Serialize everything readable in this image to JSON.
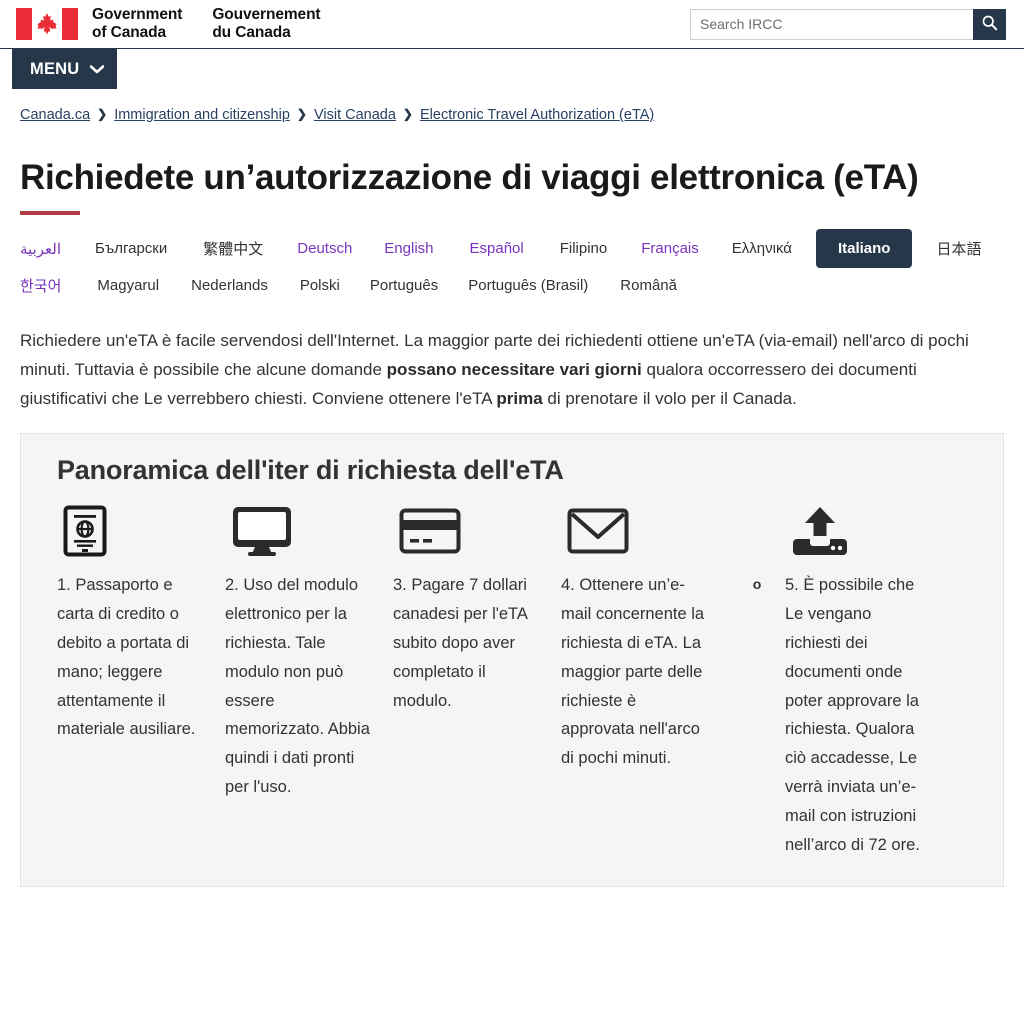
{
  "header": {
    "flag_icon": "canada-flag-icon",
    "wordmark_en": "Government\nof Canada",
    "wordmark_fr": "Gouvernement\ndu Canada",
    "search": {
      "placeholder": "Search IRCC",
      "value": "",
      "button_icon": "search-icon"
    },
    "menu": {
      "label": "MENU",
      "icon": "chevron-down-icon"
    }
  },
  "breadcrumb": {
    "separator": "❯",
    "items": [
      {
        "label": "Canada.ca"
      },
      {
        "label": "Immigration and citizenship"
      },
      {
        "label": "Visit Canada"
      },
      {
        "label": "Electronic Travel Authorization (eTA)"
      }
    ]
  },
  "page": {
    "title": "Richiedete un’autorizzazione di viaggi elettronica (eTA)"
  },
  "languages": {
    "active": "Italiano",
    "row1": [
      {
        "label": "العربية",
        "visited": true,
        "active": false
      },
      {
        "label": "Български",
        "visited": false,
        "active": false
      },
      {
        "label": "繁體中文",
        "visited": false,
        "active": false
      },
      {
        "label": "Deutsch",
        "visited": true,
        "active": false
      },
      {
        "label": "English",
        "visited": true,
        "active": false
      },
      {
        "label": "Español",
        "visited": true,
        "active": false
      },
      {
        "label": "Filipino",
        "visited": false,
        "active": false
      },
      {
        "label": "Français",
        "visited": true,
        "active": false
      },
      {
        "label": "Ελληνικά",
        "visited": false,
        "active": false
      },
      {
        "label": "Italiano",
        "visited": false,
        "active": true
      },
      {
        "label": "日本語",
        "visited": false,
        "active": false
      }
    ],
    "row2": [
      {
        "label": "한국어",
        "visited": true,
        "active": false
      },
      {
        "label": "Magyarul",
        "visited": false,
        "active": false
      },
      {
        "label": "Nederlands",
        "visited": false,
        "active": false
      },
      {
        "label": "Polski",
        "visited": false,
        "active": false
      },
      {
        "label": "Português",
        "visited": false,
        "active": false
      },
      {
        "label": "Português (Brasil)",
        "visited": false,
        "active": false
      },
      {
        "label": "Română",
        "visited": false,
        "active": false
      }
    ]
  },
  "intro": {
    "part1": "Richiedere un'eTA è facile servendosi dell'Internet. La maggior parte dei richiedenti ottiene un'eTA (via-email) nell'arco di pochi minuti. Tuttavia è possibile che alcune domande ",
    "bold1": "possano necessitare vari giorni",
    "part2": " qualora occorressero dei documenti giustificativi che Le verrebbero chiesti. Conviene ottenere l'eTA ",
    "bold2": "prima",
    "part3": " di prenotare il volo per il Canada."
  },
  "overview": {
    "title": "Panoramica dell'iter di richiesta dell'eTA",
    "or_label": "o",
    "steps": [
      {
        "icon": "passport-icon",
        "text": "1. Passaporto e carta di credito o debito a portata di mano; leggere attentamente il materiale ausiliare."
      },
      {
        "icon": "monitor-icon",
        "text": "2. Uso del modulo elettronico per la richiesta. Tale modulo non può essere memorizzato. Abbia quindi i dati pronti per l'uso."
      },
      {
        "icon": "credit-card-icon",
        "text": "3. Pagare 7 dollari canadesi per l'eTA subito dopo aver completato il modulo."
      },
      {
        "icon": "envelope-icon",
        "text": "4. Ottenere un’e-mail concernente la richiesta di eTA. La maggior parte delle richieste è approvata nell'arco di pochi minuti."
      },
      {
        "icon": "upload-icon",
        "text": "5. È possibile che Le vengano richiesti dei documenti onde poter approvare la richiesta. Qualora ciò accadesse, Le verrà inviata un’e-mail con istruzioni nell’arco di 72 ore."
      }
    ]
  },
  "colors": {
    "flag_red": "#ea2d37",
    "nav_dark": "#26374a",
    "title_rule": "#af3c43",
    "link_visited": "#7834bc",
    "breadcrumb_link": "#284162",
    "panel_bg": "#f5f5f5"
  }
}
